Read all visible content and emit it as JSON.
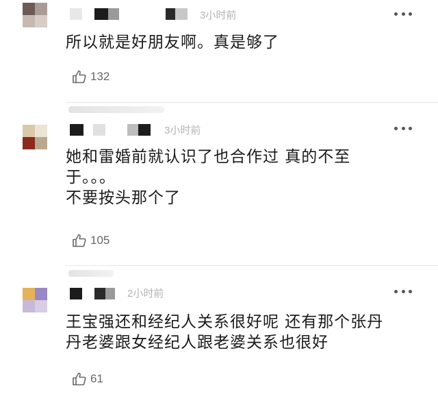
{
  "comments": [
    {
      "time": "3小时前",
      "text_lines": [
        "所以就是好朋友啊。真是够了"
      ],
      "likes": "132",
      "icons": {
        "like": "thumbs-up-icon",
        "more": "more-dots-icon"
      }
    },
    {
      "time": "3小时前",
      "text_lines": [
        "她和雷婚前就认识了也合作过 真的不至",
        "于。。。",
        "不要按头那个了"
      ],
      "likes": "105",
      "icons": {
        "like": "thumbs-up-icon",
        "more": "more-dots-icon"
      }
    },
    {
      "time": "2小时前",
      "text_lines": [
        "王宝强还和经纪人关系很好呢 还有那个张丹",
        "丹老婆跟女经纪人跟老婆关系也很好"
      ],
      "likes": "61",
      "icons": {
        "like": "thumbs-up-icon",
        "more": "more-dots-icon"
      }
    }
  ]
}
